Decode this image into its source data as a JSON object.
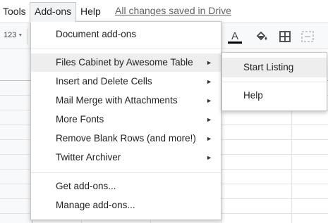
{
  "menubar": {
    "tools": "Tools",
    "addons": "Add-ons",
    "help": "Help",
    "saved_status": "All changes saved in Drive"
  },
  "toolbar": {
    "format_label": "123",
    "icons": [
      "text-color-icon",
      "fill-color-icon",
      "borders-icon",
      "merge-cells-icon"
    ],
    "text_color_bar": "#000000"
  },
  "addons_menu": {
    "items": [
      {
        "label": "Document add-ons"
      },
      {
        "label": "Files Cabinet by Awesome Table",
        "submenu": true,
        "active": true
      },
      {
        "label": "Insert and Delete Cells",
        "submenu": true
      },
      {
        "label": "Mail Merge with Attachments",
        "submenu": true
      },
      {
        "label": "More Fonts",
        "submenu": true
      },
      {
        "label": "Remove Blank Rows (and more!)",
        "submenu": true
      },
      {
        "label": "Twitter Archiver",
        "submenu": true
      },
      {
        "label": "Get add-ons..."
      },
      {
        "label": "Manage add-ons..."
      }
    ],
    "arrow_glyph": "►"
  },
  "submenu": {
    "items": [
      {
        "label": "Start Listing",
        "active": true
      },
      {
        "label": "Help"
      }
    ]
  }
}
